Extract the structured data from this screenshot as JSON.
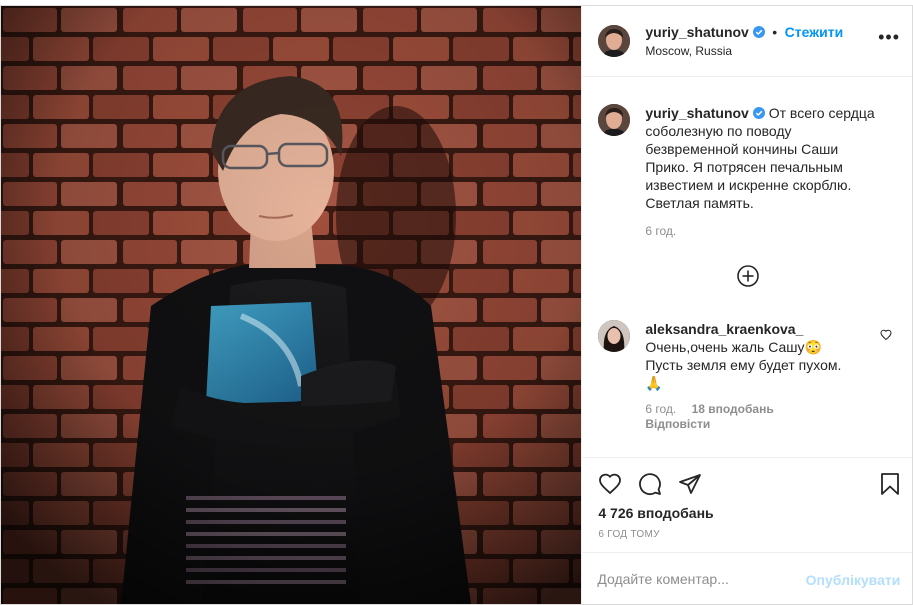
{
  "post": {
    "author": {
      "username": "yuriy_shatunov",
      "location": "Moscow, Russia",
      "follow_label": "Стежити"
    },
    "more_icon": "more-horizontal-icon",
    "caption": {
      "username": "yuriy_shatunov",
      "lines": [
        "От всего сердца",
        "соболезную по поводу",
        "безвременной кончины Саши",
        "Прико. Я потрясен печальным",
        "известием и искренне скорблю.",
        "Светлая память."
      ],
      "time": "6 год."
    },
    "load_more_icon": "plus-circle-icon",
    "comments": [
      {
        "username": "aleksandra_kraenkova_",
        "lines": [
          "Очень,очень жаль Сашу😳",
          "Пусть земля ему будет пухом.",
          "🙏"
        ],
        "time": "6 год.",
        "likes": "18 вподобань",
        "reply_label": "Відповісти"
      }
    ],
    "actions": {
      "like_icon": "heart-icon",
      "comment_icon": "comment-icon",
      "share_icon": "paper-plane-icon",
      "save_icon": "bookmark-icon"
    },
    "likes_count": "4 726 вподобань",
    "posted_ago": "6 год тому",
    "add_comment": {
      "placeholder": "Додайте коментар...",
      "publish_label": "Опублікувати"
    },
    "colors": {
      "accent": "#0095f6",
      "publish_disabled": "#b2dffc",
      "verified": "#3897f0",
      "secondary_text": "#8e8e8e"
    }
  }
}
